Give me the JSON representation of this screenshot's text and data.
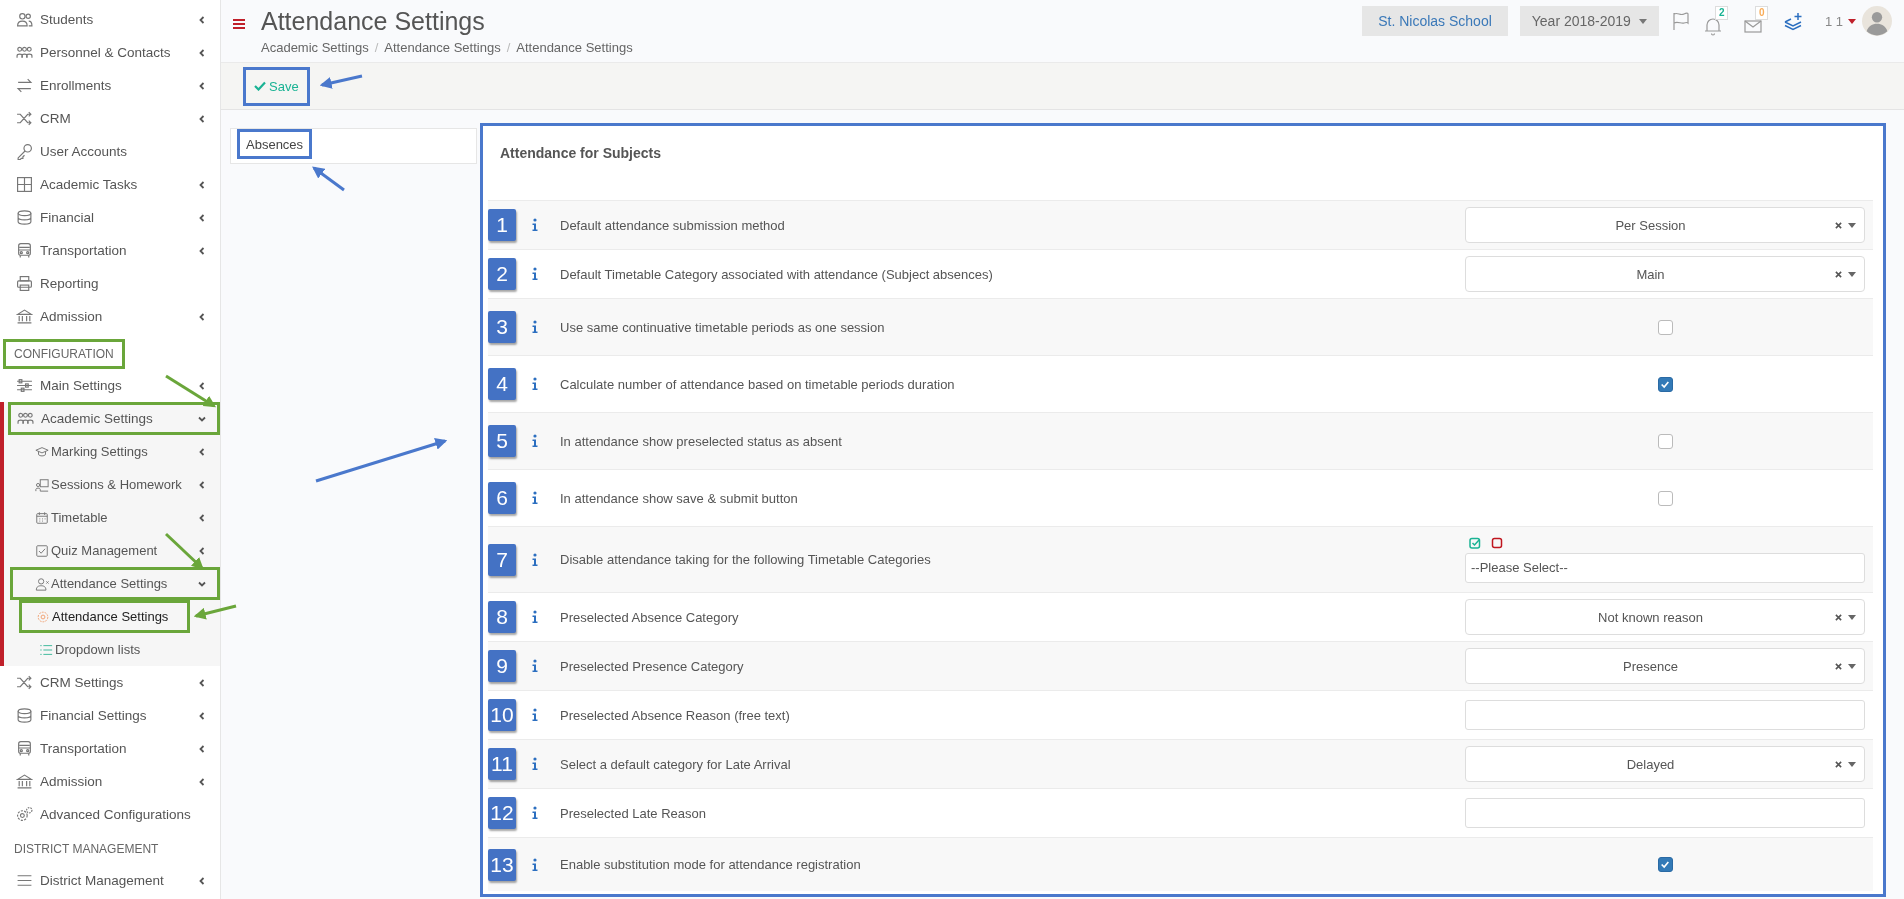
{
  "sidebar": {
    "items": [
      {
        "label": "Students",
        "kind": "group",
        "expanded": false,
        "selected": false,
        "annotated": false
      },
      {
        "label": "Personnel & Contacts",
        "kind": "group",
        "expanded": false,
        "selected": false,
        "annotated": false
      },
      {
        "label": "Enrollments",
        "kind": "group",
        "expanded": false,
        "selected": false,
        "annotated": false
      },
      {
        "label": "CRM",
        "kind": "group",
        "expanded": false,
        "selected": false,
        "annotated": false
      },
      {
        "label": "User Accounts",
        "kind": "link",
        "selected": false,
        "annotated": false
      },
      {
        "label": "Academic Tasks",
        "kind": "group",
        "expanded": false,
        "selected": false,
        "annotated": false
      },
      {
        "label": "Financial",
        "kind": "group",
        "expanded": false,
        "selected": false,
        "annotated": false
      },
      {
        "label": "Transportation",
        "kind": "group",
        "expanded": false,
        "selected": false,
        "annotated": false
      },
      {
        "label": "Reporting",
        "kind": "link",
        "selected": false,
        "annotated": false
      },
      {
        "label": "Admission",
        "kind": "group",
        "expanded": false,
        "selected": false,
        "annotated": false
      }
    ],
    "sections": [
      {
        "title": "CONFIGURATION",
        "annotated": true,
        "items": [
          {
            "label": "Main Settings",
            "kind": "group",
            "expanded": false,
            "selected": false,
            "annotated": false
          },
          {
            "label": "Academic Settings",
            "kind": "group",
            "expanded": true,
            "selected": false,
            "annotated": true,
            "children": [
              {
                "label": "Marking Settings",
                "kind": "group",
                "expanded": false,
                "selected": false,
                "annotated": false
              },
              {
                "label": "Sessions & Homework",
                "kind": "group",
                "expanded": false,
                "selected": false,
                "annotated": false
              },
              {
                "label": "Timetable",
                "kind": "group",
                "expanded": false,
                "selected": false,
                "annotated": false
              },
              {
                "label": "Quiz Management",
                "kind": "group",
                "expanded": false,
                "selected": false,
                "annotated": false
              },
              {
                "label": "Attendance Settings",
                "kind": "group",
                "expanded": true,
                "selected": false,
                "annotated": true,
                "children": [
                  {
                    "label": "Attendance Settings",
                    "selected": true,
                    "annotated": true
                  },
                  {
                    "label": "Dropdown lists",
                    "selected": false,
                    "annotated": false
                  }
                ]
              }
            ]
          },
          {
            "label": "CRM Settings",
            "kind": "group",
            "expanded": false,
            "selected": false,
            "annotated": false
          },
          {
            "label": "Financial Settings",
            "kind": "group",
            "expanded": false,
            "selected": false,
            "annotated": false
          },
          {
            "label": "Transportation",
            "kind": "group",
            "expanded": false,
            "selected": false,
            "annotated": false
          },
          {
            "label": "Admission",
            "kind": "group",
            "expanded": false,
            "selected": false,
            "annotated": false
          },
          {
            "label": "Advanced Configurations",
            "kind": "link",
            "selected": false,
            "annotated": false
          }
        ]
      },
      {
        "title": "DISTRICT MANAGEMENT",
        "annotated": false,
        "items": [
          {
            "label": "District Management",
            "kind": "group",
            "expanded": false,
            "selected": false,
            "annotated": false
          }
        ]
      }
    ]
  },
  "header": {
    "title": "Attendance Settings",
    "breadcrumbs": [
      "Academic Settings",
      "Attendance Settings",
      "Attendance Settings"
    ],
    "separator": "/",
    "school": "St. Nicolas School",
    "year": "Year 2018-2019",
    "notifications": "2",
    "messages": "0",
    "user": "1 1"
  },
  "toolbar": {
    "save": "Save",
    "annotated": true
  },
  "tabs": [
    {
      "label": "Absences",
      "selected": true,
      "annotated": true
    }
  ],
  "panel": {
    "title": "Attendance for Subjects",
    "annotated": true,
    "settings": [
      {
        "number": "1",
        "label": "Default attendance submission method",
        "kind": "select",
        "value": "Per Session"
      },
      {
        "number": "2",
        "label": "Default Timetable Category associated with attendance (Subject absences)",
        "kind": "select",
        "value": "Main"
      },
      {
        "number": "3",
        "label": "Use same continuative timetable periods as one session",
        "kind": "checkbox",
        "checked": false
      },
      {
        "number": "4",
        "label": "Calculate number of  attendance based on timetable periods duration",
        "kind": "checkbox",
        "checked": true
      },
      {
        "number": "5",
        "label": "In attendance show preselected status as absent",
        "kind": "checkbox",
        "checked": false
      },
      {
        "number": "6",
        "label": "In attendance show save & submit button",
        "kind": "checkbox",
        "checked": false
      },
      {
        "number": "7",
        "label": "Disable attendance taking for the following Timetable Categories",
        "kind": "multiselect",
        "placeholder": "--Please Select--"
      },
      {
        "number": "8",
        "label": "Preselected Absence Category",
        "kind": "select",
        "value": "Not known reason"
      },
      {
        "number": "9",
        "label": "Preselected Presence Category",
        "kind": "select",
        "value": "Presence"
      },
      {
        "number": "10",
        "label": "Preselected Absence Reason (free text)",
        "kind": "text"
      },
      {
        "number": "11",
        "label": "Select a default category for Late Arrival",
        "kind": "select",
        "value": "Delayed"
      },
      {
        "number": "12",
        "label": "Preselected Late Reason",
        "kind": "text"
      },
      {
        "number": "13",
        "label": "Enable substitution mode for attendance registration",
        "kind": "checkbox",
        "checked": true
      }
    ]
  }
}
